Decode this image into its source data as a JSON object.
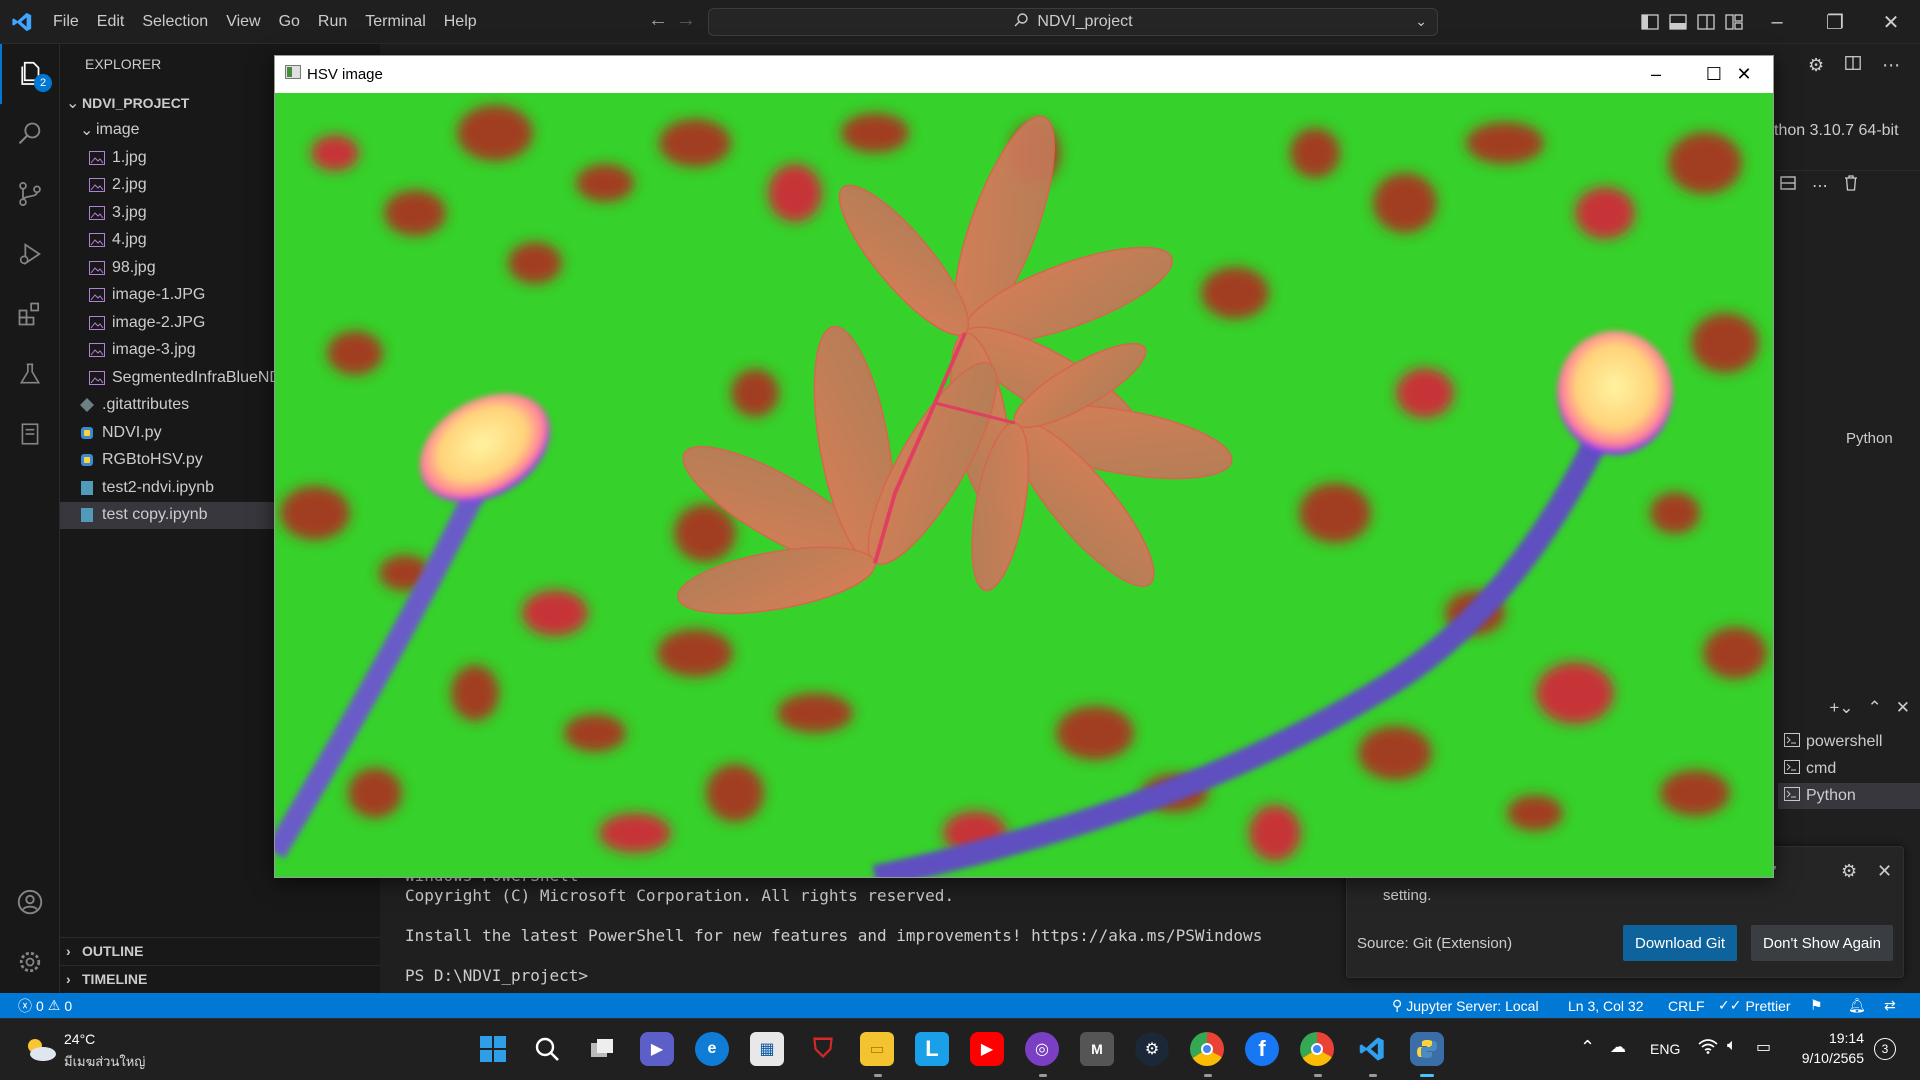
{
  "titlebar": {
    "menu": [
      "File",
      "Edit",
      "Selection",
      "View",
      "Go",
      "Run",
      "Terminal",
      "Help"
    ],
    "search_text": "NDVI_project"
  },
  "activitybar": {
    "explorer_badge": "2"
  },
  "sidebar": {
    "title": "EXPLORER",
    "project": "NDVI_PROJECT",
    "folder": "image",
    "files_in_image": [
      "1.jpg",
      "2.jpg",
      "3.jpg",
      "4.jpg",
      "98.jpg",
      "image-1.JPG",
      "image-2.JPG",
      "image-3.jpg",
      "SegmentedInfraBlueNDVI.jpg"
    ],
    "root_files": [
      ".gitattributes",
      "NDVI.py",
      "RGBtoHSV.py",
      "test2-ndvi.ipynb",
      "test copy.ipynb"
    ],
    "outline": "OUTLINE",
    "timeline": "TIMELINE"
  },
  "right_panel": {
    "kernel": "thon 3.10.7 64-bit",
    "python_label": "Python",
    "terminals": [
      "powershell",
      "cmd",
      "Python"
    ]
  },
  "terminal": {
    "line1": "Windows PowerShell",
    "line2": "Copyright (C) Microsoft Corporation. All rights reserved.",
    "line3": "Install the latest PowerShell for new features and improvements! https://aka.ms/PSWindows",
    "line4": "PS D:\\NDVI_project>"
  },
  "notification": {
    "partial": "th'",
    "message": "setting.",
    "source": "Source: Git (Extension)",
    "download": "Download Git",
    "dont_show": "Don't Show Again"
  },
  "statusbar": {
    "errors": "0",
    "warnings": "0",
    "jupyter": "Jupyter Server: Local",
    "position": "Ln 3, Col 32",
    "eol": "CRLF",
    "prettier": "Prettier"
  },
  "hsv_window": {
    "title": "HSV image"
  },
  "taskbar": {
    "weather_temp": "24°C",
    "weather_desc": "มีเมฆส่วนใหญ่",
    "lang": "ENG",
    "time": "19:14",
    "date": "9/10/2565",
    "notif_count": "3"
  },
  "colors": {
    "accent": "#0078d4",
    "editor_bg": "#1f1f1f",
    "sidebar_bg": "#181818",
    "hsv_green": "#3fd62a",
    "hsv_red": "#c8201c"
  }
}
